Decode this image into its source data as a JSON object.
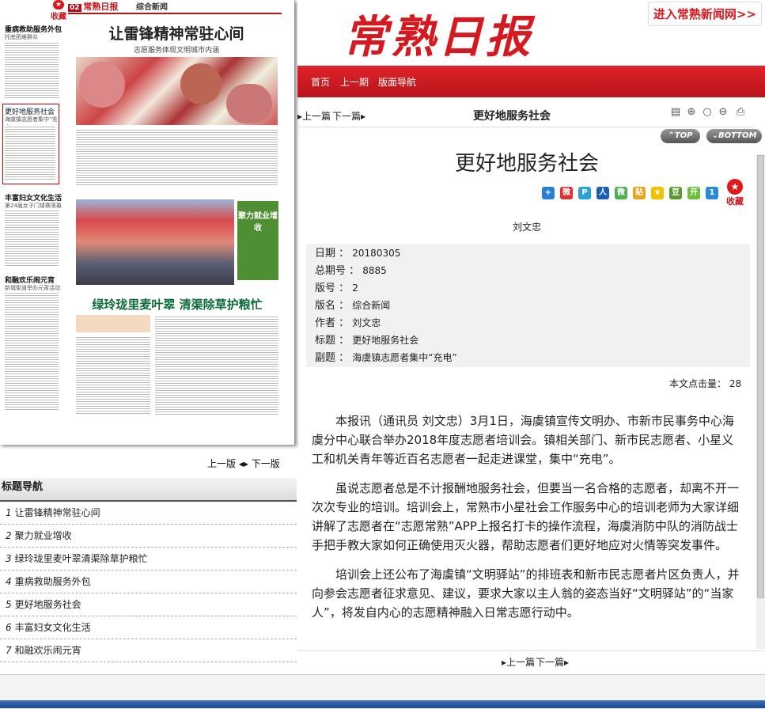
{
  "newspaper": {
    "logo": "常熟日报",
    "section_no": "02",
    "section_name": "综合新闻",
    "collect_label": "收藏",
    "headline": "让雷锋精神常驻心间",
    "subheadline": "志愿服务体现文明城市内涵",
    "banner_headline": "绿玲珑里麦叶翠 清渠除草护粮忙",
    "side_box": "聚力就业增收",
    "side_items": [
      {
        "title": "重病救助服务外包",
        "sub": "托底困难群众"
      },
      {
        "title": "更好地服务社会",
        "sub": "海虞镇志愿者集中“充电”"
      },
      {
        "title": "丰富妇女文化生活",
        "sub": "第24届女子门球赛落幕"
      },
      {
        "title": "和融欢乐闹元宵",
        "sub": "新城街道举办元宵活动"
      }
    ]
  },
  "page_nav": {
    "prev": "上一版",
    "next": "下一版"
  },
  "toc": {
    "title": "标题导航",
    "items": [
      {
        "num": "1",
        "label": "让雷锋精神常驻心间"
      },
      {
        "num": "2",
        "label": "聚力就业增收"
      },
      {
        "num": "3",
        "label": "绿玲珑里麦叶翠清渠除草护粮忙"
      },
      {
        "num": "4",
        "label": "重病救助服务外包"
      },
      {
        "num": "5",
        "label": "更好地服务社会"
      },
      {
        "num": "6",
        "label": "丰富妇女文化生活"
      },
      {
        "num": "7",
        "label": "和融欢乐闹元宵"
      }
    ]
  },
  "masthead": {
    "brand": "常熟日报",
    "enter_link": "进入常熟新闻网>>"
  },
  "nav": {
    "home": "首页",
    "prev_issue": "上一期",
    "layout_nav": "版面导航"
  },
  "toolbar": {
    "prev": "上一篇",
    "next": "下一篇",
    "title": "更好地服务社会"
  },
  "scroll_buttons": {
    "top": "TOP",
    "bottom": "BOTTOM"
  },
  "article": {
    "title": "更好地服务社会",
    "author": "刘文忠",
    "collect_label": "收藏",
    "meta": [
      {
        "label": "日期",
        "value": "20180305"
      },
      {
        "label": "总期号",
        "value": "8885"
      },
      {
        "label": "版号",
        "value": "2"
      },
      {
        "label": "版名",
        "value": "综合新闻"
      },
      {
        "label": "作者",
        "value": "刘文忠"
      },
      {
        "label": "标题",
        "value": "更好地服务社会"
      },
      {
        "label": "副题",
        "value": "海虞镇志愿者集中“充电”"
      }
    ],
    "hits_label": "本文点击量：",
    "hits_value": "28",
    "paragraphs": [
      "本报讯（通讯员 刘文忠）3月1日，海虞镇宣传文明办、市新市民事务中心海虞分中心联合举办2018年度志愿者培训会。镇相关部门、新市民志愿者、小星义工和机关青年等近百名志愿者一起走进课堂，集中“充电”。",
      "虽说志愿者总是不计报酬地服务社会，但要当一名合格的志愿者，却离不开一次次专业的培训。培训会上，常熟市小星社会工作服务中心的培训老师为大家详细讲解了志愿者在“志愿常熟”APP上报名打卡的操作流程，海虞消防中队的消防战士手把手教大家如何正确使用灭火器，帮助志愿者们更好地应对火情等突发事件。",
      "培训会上还公布了海虞镇“文明驿站”的排班表和新市民志愿者片区负责人，并向参会志愿者征求意见、建议，要求大家以主人翁的姿态当好“文明驿站”的“当家人”，将发自内心的志愿精神融入日常志愿行动中。"
    ]
  },
  "bottom_nav": {
    "prev": "上一篇",
    "next": "下一篇"
  },
  "colors": {
    "brand_red": "#d41a20",
    "nav_red": "#c8161d",
    "meta_bg": "#f1f1f1"
  }
}
